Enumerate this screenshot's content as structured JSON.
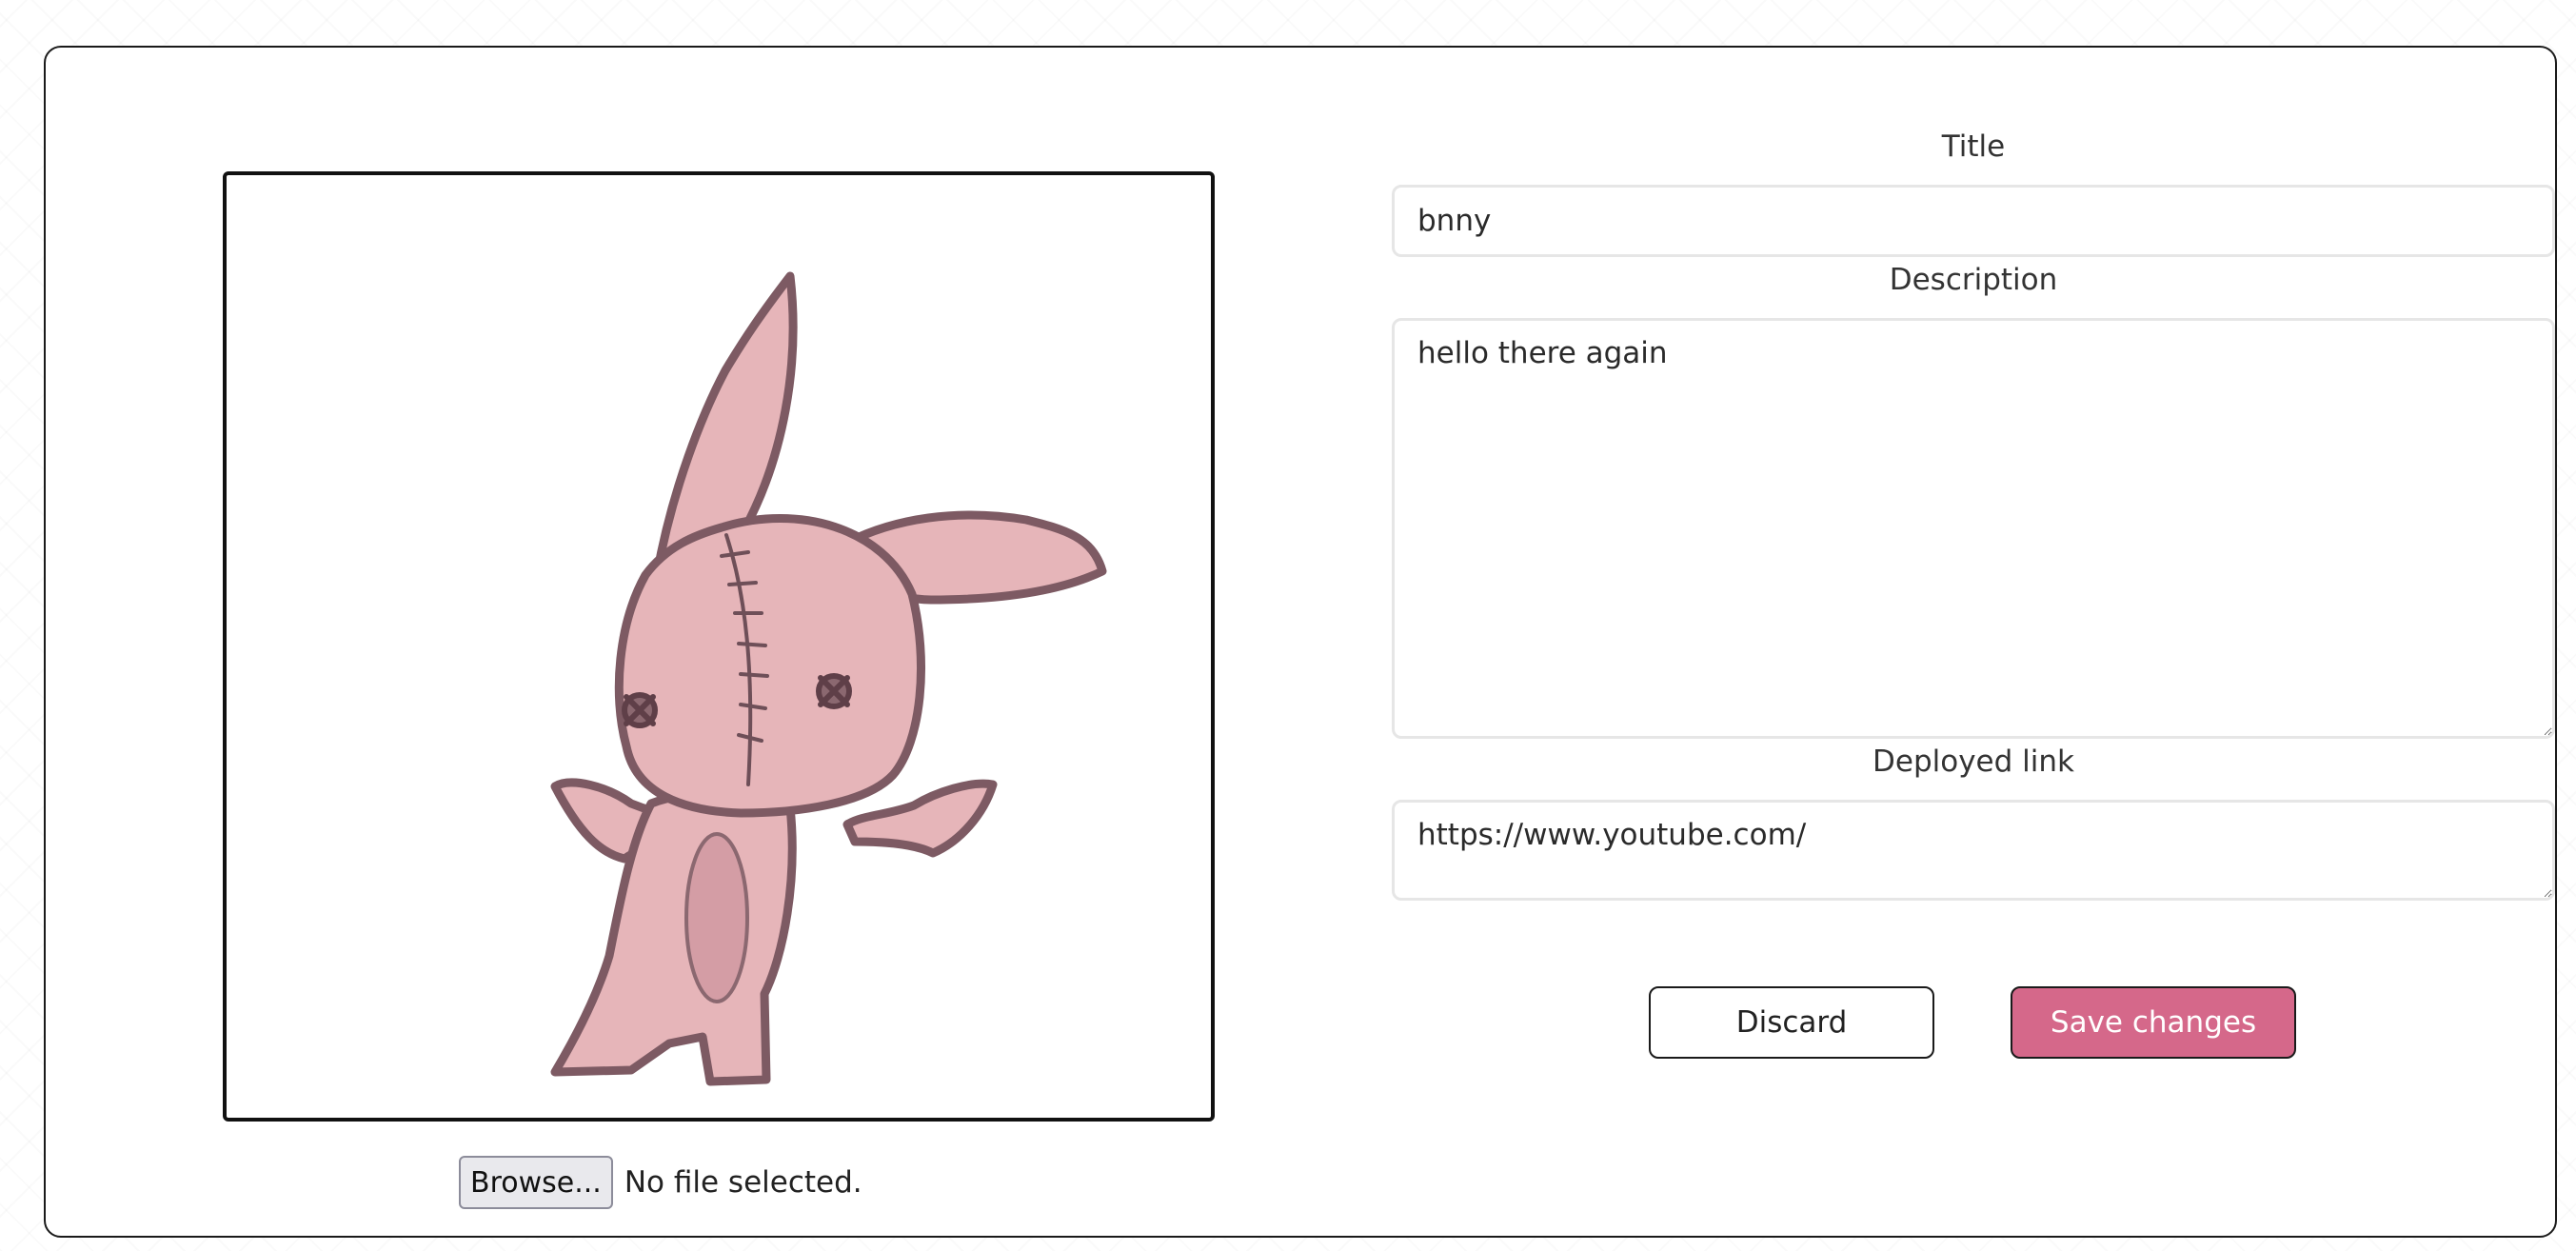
{
  "editor": {
    "image": {
      "subject": "pink stitched bunny with wings drawing",
      "icon": "bunny-illustration"
    },
    "file_input": {
      "button_label": "Browse...",
      "status": "No file selected."
    },
    "form": {
      "title_label": "Title",
      "title_value": "bnny",
      "description_label": "Description",
      "description_value": "hello there again",
      "link_label": "Deployed link",
      "link_value": "https://www.youtube.com/"
    },
    "actions": {
      "discard_label": "Discard",
      "save_label": "Save changes"
    },
    "colors": {
      "accent": "#d5688a",
      "border": "#1a1a1a",
      "field_border": "#e6e6e6"
    }
  }
}
